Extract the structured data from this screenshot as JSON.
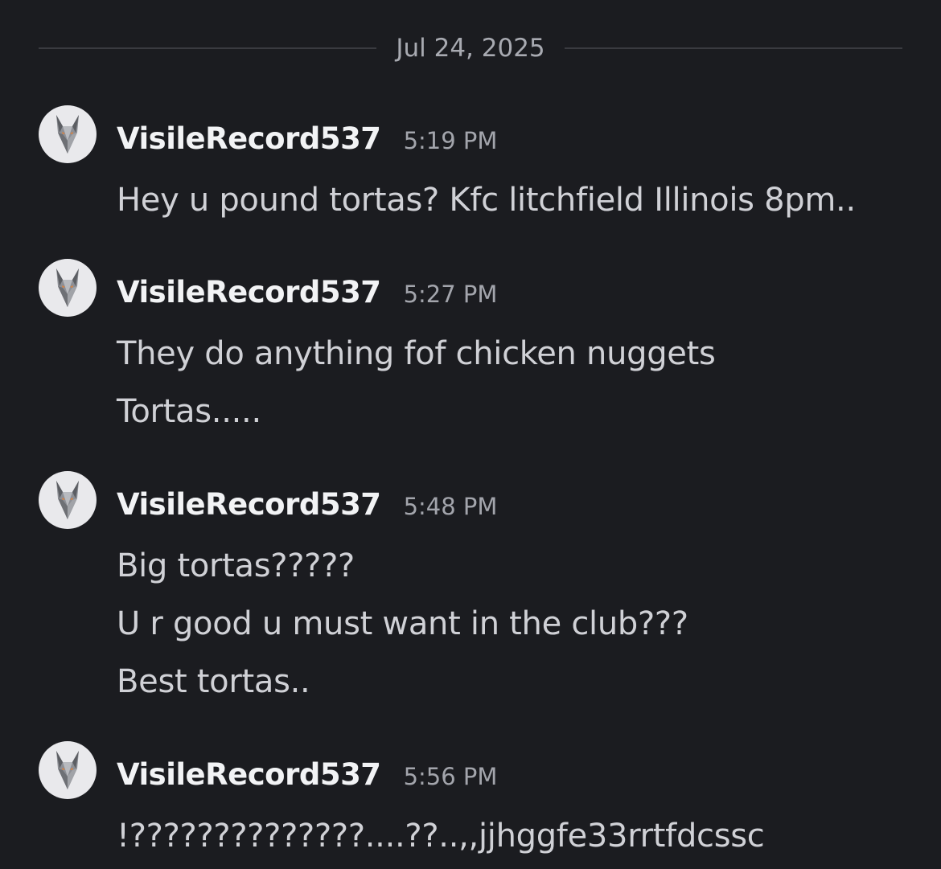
{
  "date_divider": "Jul 24, 2025",
  "messages": [
    {
      "username": "VisileRecord537",
      "time": "5:19 PM",
      "lines": [
        "Hey u pound tortas? Kfc litchfield Illinois 8pm.."
      ]
    },
    {
      "username": "VisileRecord537",
      "time": "5:27 PM",
      "lines": [
        "They do anything fof chicken nuggets",
        "Tortas....."
      ]
    },
    {
      "username": "VisileRecord537",
      "time": "5:48 PM",
      "lines": [
        "Big tortas?????",
        "U r good u must want in the club???",
        "Best tortas.."
      ]
    },
    {
      "username": "VisileRecord537",
      "time": "5:56 PM",
      "lines": [
        "!??????????????....??..,,jjhggfe33rrtfdcssc"
      ]
    }
  ],
  "colors": {
    "background": "#1b1c20",
    "username": "#f2f3f5",
    "timestamp": "#a3a5ac",
    "message_text": "#d0d1d6",
    "divider_line": "#3a3b40"
  },
  "icons": {
    "avatar": "wolf-head-avatar-icon"
  }
}
